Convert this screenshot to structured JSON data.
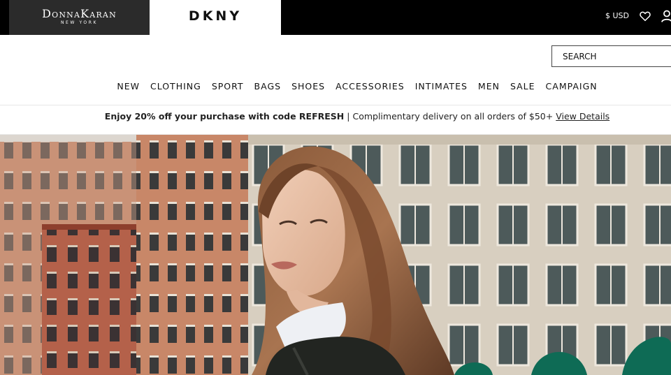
{
  "header": {
    "brand_donna": "DONNA KARAN",
    "brand_donna_letters": [
      "D",
      "ONNA",
      "K",
      "ARAN"
    ],
    "brand_newyork": "NEW YORK",
    "brand_dkny": "DKNY",
    "currency": "$ USD"
  },
  "icons": {
    "wishlist": "heart-icon",
    "account": "user-icon"
  },
  "search": {
    "placeholder": "SEARCH"
  },
  "nav": {
    "items": [
      "NEW",
      "CLOTHING",
      "SPORT",
      "BAGS",
      "SHOES",
      "ACCESSORIES",
      "INTIMATES",
      "MEN",
      "SALE",
      "CAMPAIGN"
    ]
  },
  "promo": {
    "bold_text": "Enjoy 20% off your purchase with code REFRESH",
    "separator": "|",
    "text": "Complimentary delivery on all orders of $50+",
    "link": "View Details"
  },
  "colors": {
    "topbar": "#000000",
    "donna_block": "#2b2b2b",
    "text": "#111111",
    "awning_green": "#0e6b55"
  }
}
